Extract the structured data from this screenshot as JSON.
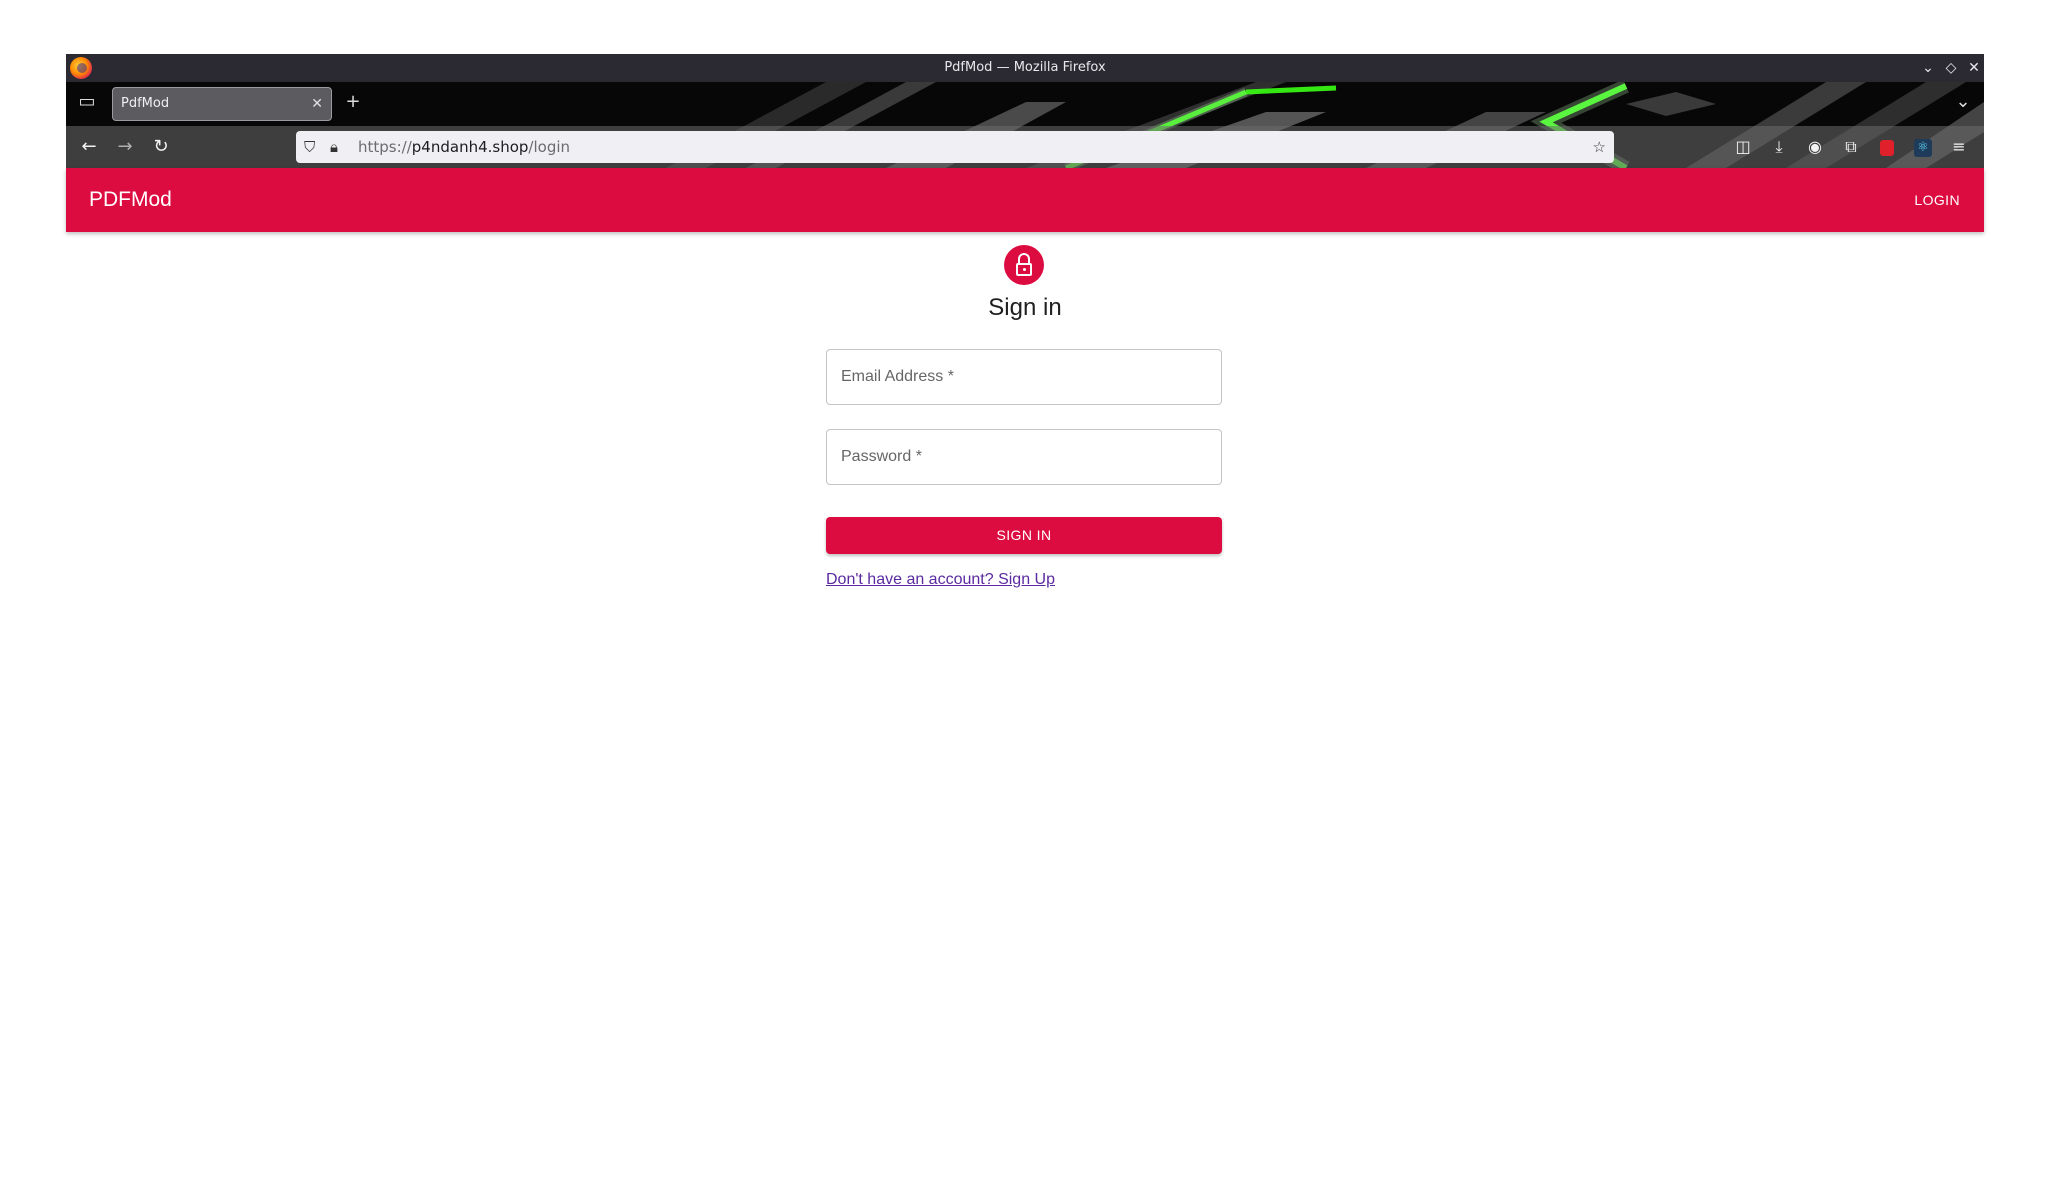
{
  "window": {
    "title": "PdfMod — Mozilla Firefox",
    "controls": {
      "minimize": "⌄",
      "maximize": "◇",
      "close": "✕"
    }
  },
  "browser": {
    "tab": {
      "title": "PdfMod",
      "close": "✕"
    },
    "new_tab": "+",
    "tab_list": "⌄",
    "nav": {
      "back": "←",
      "forward": "→",
      "reload": "↻"
    },
    "url": {
      "scheme": "https://",
      "host": "p4ndanh4.shop",
      "path": "/login"
    },
    "toolbar_icons": [
      "pocket-icon",
      "download-icon",
      "account-icon",
      "extensions-icon",
      "ublock-icon",
      "react-devtools-icon",
      "menu-icon"
    ],
    "theme_accent": "#39ff14"
  },
  "app": {
    "brand": "PDFMod",
    "nav_login": "LOGIN",
    "accent": "#dc0b40"
  },
  "form": {
    "heading": "Sign in",
    "email_placeholder": "Email Address *",
    "password_placeholder": "Password *",
    "submit": "SIGN IN",
    "signup_link": "Don't have an account? Sign Up"
  }
}
